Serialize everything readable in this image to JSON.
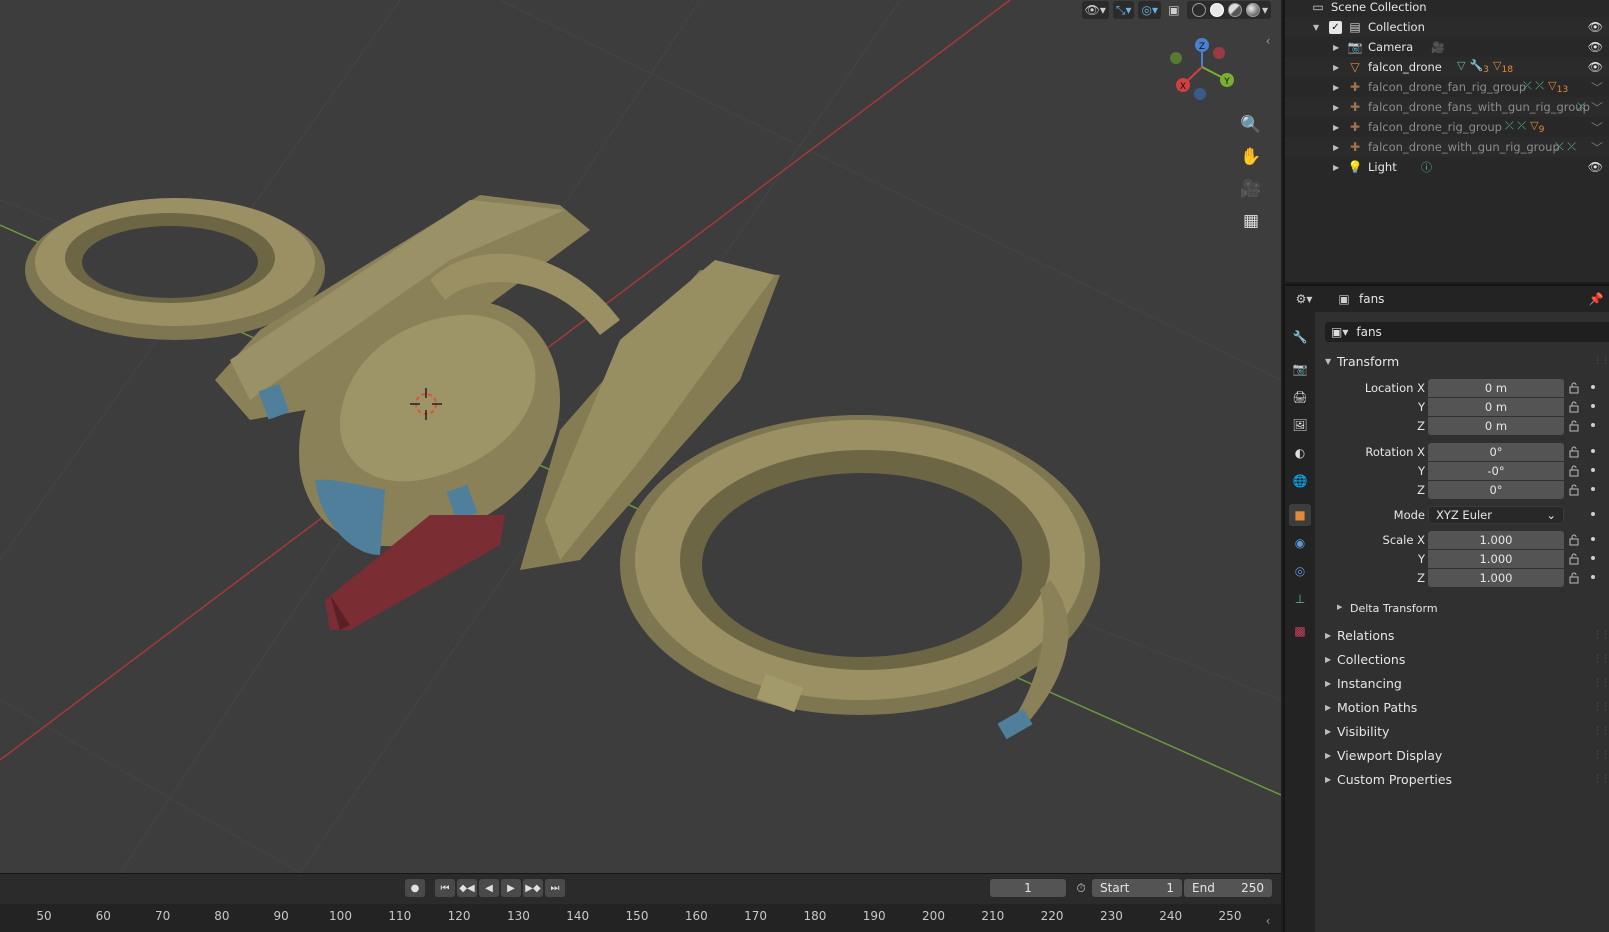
{
  "colors": {
    "viewport_bg": "#3d3d3d",
    "model_body": "#8f865a",
    "model_metal": "#4f7f9a",
    "model_gun": "#7a2e33",
    "axis_x": "#c04040",
    "axis_y": "#6ca040",
    "active_tab": "#e08a3a"
  },
  "viewport": {
    "header_icons": [
      "visibility-icon",
      "gizmo-icon",
      "overlay-icon",
      "xray-icon",
      "wireframe-shading",
      "solid-shading",
      "material-shading",
      "rendered-shading"
    ],
    "navigation_gizmo": {
      "x_label": "X",
      "y_label": "Y",
      "z_label": "Z"
    },
    "tools": [
      "zoom-icon",
      "pan-hand-icon",
      "camera-view-icon",
      "ortho-grid-icon"
    ]
  },
  "timeline": {
    "current_frame": "1",
    "start_label": "Start",
    "start_value": "1",
    "end_label": "End",
    "end_value": "250",
    "ruler_ticks": [
      "50",
      "60",
      "70",
      "80",
      "90",
      "100",
      "110",
      "120",
      "130",
      "140",
      "150",
      "160",
      "170",
      "180",
      "190",
      "200",
      "210",
      "220",
      "230",
      "240",
      "250"
    ]
  },
  "outliner": {
    "root": "Scene Collection",
    "items": [
      {
        "label": "Collection",
        "icon": "collection-icon",
        "visible": true
      },
      {
        "label": "Camera",
        "icon": "camera-icon",
        "visible": true
      },
      {
        "label": "falcon_drone",
        "icon": "mesh-icon",
        "visible": true,
        "badge_a": "3",
        "badge_b": "18"
      },
      {
        "label": "falcon_drone_fan_rig_group",
        "icon": "armature-icon",
        "visible": false,
        "badge": "13"
      },
      {
        "label": "falcon_drone_fans_with_gun_rig_group",
        "icon": "armature-icon",
        "visible": false
      },
      {
        "label": "falcon_drone_rig_group",
        "icon": "armature-icon",
        "visible": false,
        "badge": "9"
      },
      {
        "label": "falcon_drone_with_gun_rig_group",
        "icon": "armature-icon",
        "visible": false
      },
      {
        "label": "Light",
        "icon": "light-icon",
        "visible": true
      }
    ]
  },
  "properties": {
    "context_name": "fans",
    "object_name": "fans",
    "transform": {
      "title": "Transform",
      "location_label": "Location X",
      "location": [
        "0 m",
        "0 m",
        "0 m"
      ],
      "rotation_label": "Rotation X",
      "rotation": [
        "0°",
        "-0°",
        "0°"
      ],
      "mode_label": "Mode",
      "mode_value": "XYZ Euler",
      "scale_label": "Scale X",
      "scale": [
        "1.000",
        "1.000",
        "1.000"
      ],
      "y_label": "Y",
      "z_label": "Z",
      "delta": "Delta Transform"
    },
    "panels": [
      "Relations",
      "Collections",
      "Instancing",
      "Motion Paths",
      "Visibility",
      "Viewport Display",
      "Custom Properties"
    ]
  }
}
